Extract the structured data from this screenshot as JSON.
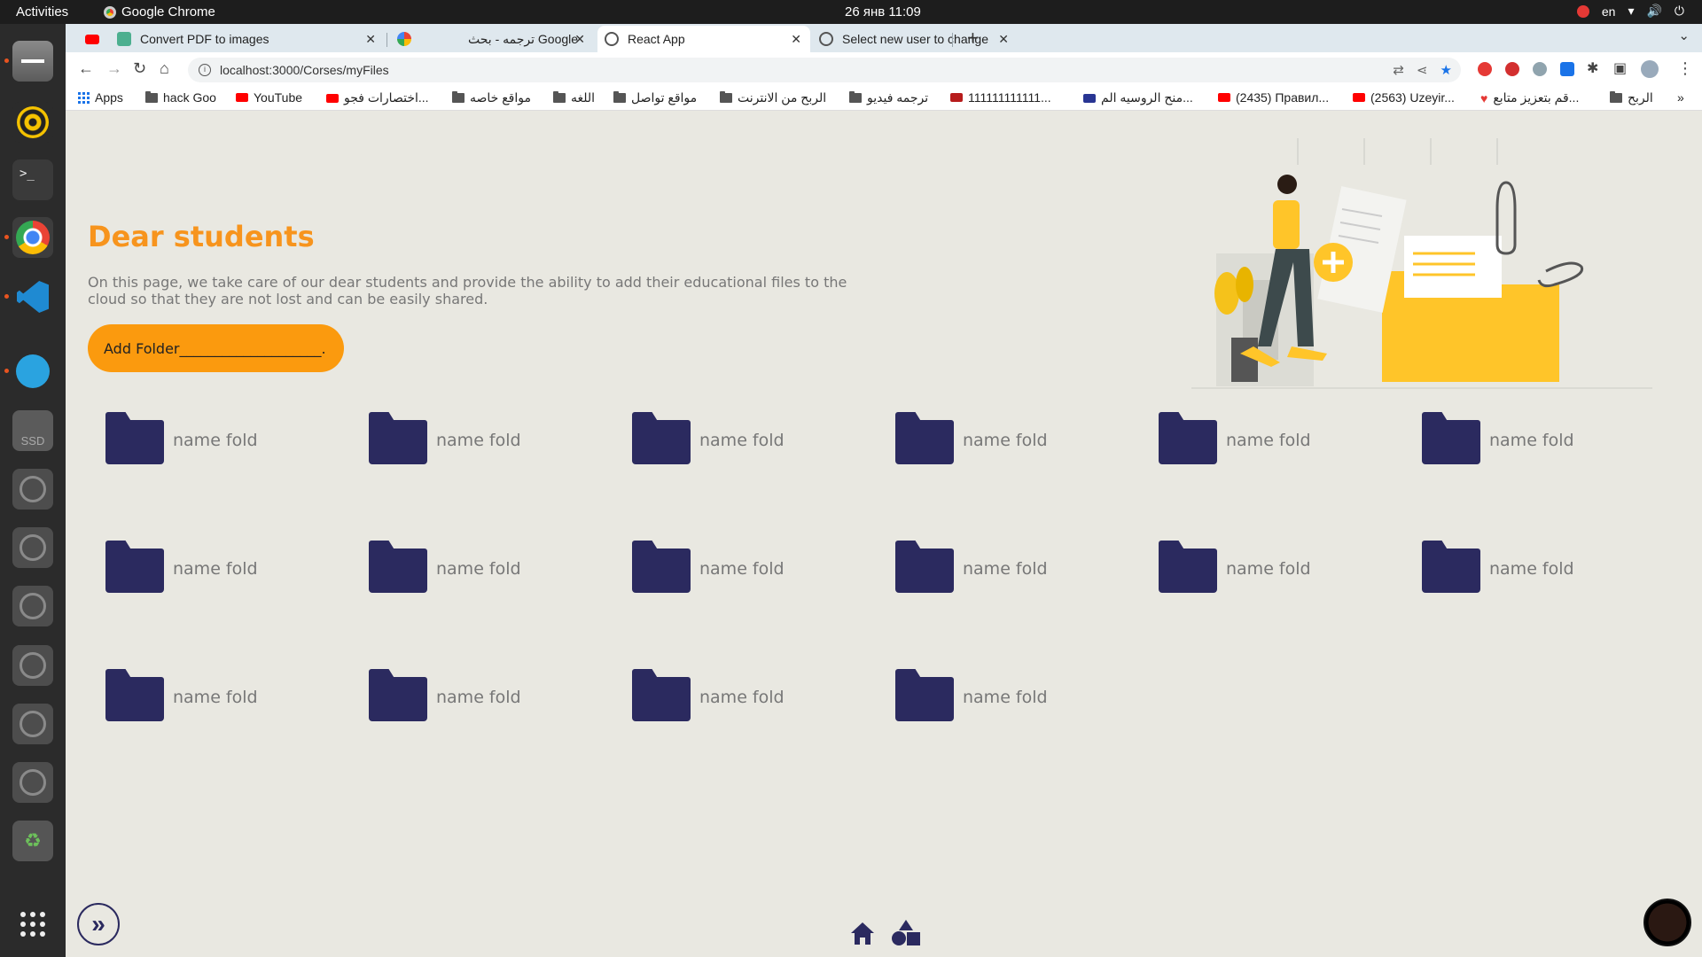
{
  "system": {
    "activities": "Activities",
    "app_name": "Google Chrome",
    "clock": "26 янв  11:09",
    "language": "en"
  },
  "tabs": [
    {
      "label": "Convert PDF to images",
      "icon": "pdf-favicon"
    },
    {
      "label": "ترجمه - بحث Google",
      "icon": "google-favicon"
    },
    {
      "label": "React App",
      "icon": "globe-favicon",
      "active": true
    },
    {
      "label": "Select new user to change",
      "icon": "globe-favicon"
    }
  ],
  "address_bar": {
    "url": "localhost:3000/Corses/myFiles"
  },
  "bookmarks": [
    {
      "label": "Apps",
      "icon": "apps-icon"
    },
    {
      "label": "hack Goo",
      "icon": "folder-icon"
    },
    {
      "label": "YouTube",
      "icon": "youtube-icon"
    },
    {
      "label": "اختصارات فجو...",
      "icon": "youtube-icon"
    },
    {
      "label": "مواقع خاصه",
      "icon": "folder-icon"
    },
    {
      "label": "اللغه",
      "icon": "folder-icon"
    },
    {
      "label": "مواقع تواصل",
      "icon": "folder-icon"
    },
    {
      "label": "الربح من الانترنت",
      "icon": "folder-icon"
    },
    {
      "label": "ترجمه فيديو",
      "icon": "folder-icon"
    },
    {
      "label": "111111111111...",
      "icon": "site-icon"
    },
    {
      "label": "منح الروسيه الم...",
      "icon": "site-icon"
    },
    {
      "label": "(2435) Правил...",
      "icon": "youtube-icon"
    },
    {
      "label": "(2563) Uzeyir...",
      "icon": "youtube-icon"
    },
    {
      "label": "قم بتعزيز متابع...",
      "icon": "heart-icon"
    },
    {
      "label": "الربح",
      "icon": "folder-icon"
    },
    {
      "label": "»",
      "icon": ""
    }
  ],
  "main": {
    "title": "Dear students",
    "description": "On this page, we take care of our dear students and provide the ability to add their educational files to the cloud so that they are not lost and can be easily shared.",
    "add_folder_label": "Add Folder____________________."
  },
  "folders": [
    "name fold",
    "name fold",
    "name fold",
    "name fold",
    "name fold",
    "name fold",
    "name fold",
    "name fold",
    "name fold",
    "name fold",
    "name fold",
    "name fold",
    "name fold",
    "name fold",
    "name fold",
    "name fold"
  ],
  "colors": {
    "accent": "#f7941d",
    "button": "#fb9a0e",
    "folder": "#2b2a5f",
    "background": "#e9e8e1"
  }
}
